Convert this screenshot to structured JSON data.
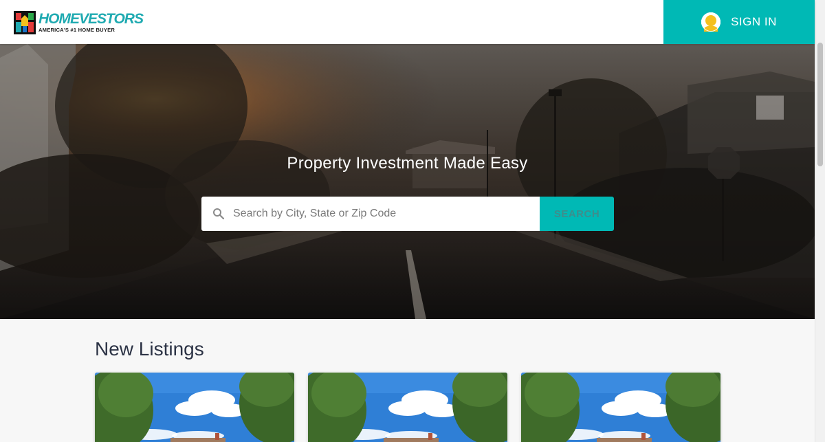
{
  "header": {
    "logo_brand": "HOMEVESTORS",
    "logo_tagline": "AMERICA'S #1 HOME BUYER",
    "signin_label": "SIGN IN"
  },
  "hero": {
    "title": "Property Investment Made Easy",
    "search_placeholder": "Search by City, State or Zip Code",
    "search_button": "SEARCH"
  },
  "listings": {
    "title": "New Listings",
    "cards": [
      {
        "image": "house-photo"
      },
      {
        "image": "house-photo"
      },
      {
        "image": "house-photo"
      }
    ]
  },
  "colors": {
    "accent": "#00b9b5",
    "brand": "#1faab1",
    "heading": "#2c3345"
  },
  "icons": [
    "user-avatar-icon",
    "search-icon",
    "logo-house-icon"
  ]
}
